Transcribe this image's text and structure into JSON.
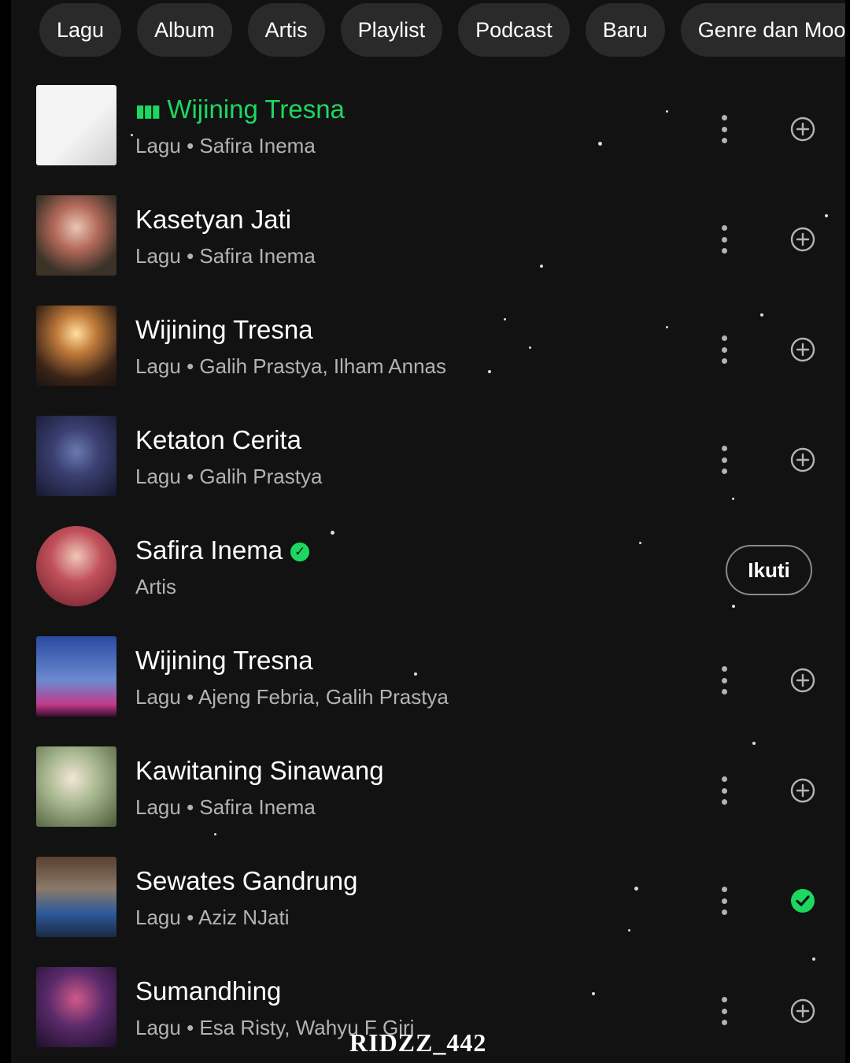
{
  "filters": [
    "Lagu",
    "Album",
    "Artis",
    "Playlist",
    "Podcast",
    "Baru",
    "Genre dan Mood"
  ],
  "results": [
    {
      "title": "Wijining Tresna",
      "type": "Lagu",
      "artists": "Safira Inema",
      "playing": true,
      "saved": false
    },
    {
      "title": "Kasetyan Jati",
      "type": "Lagu",
      "artists": "Safira Inema",
      "playing": false,
      "saved": false
    },
    {
      "title": "Wijining Tresna",
      "type": "Lagu",
      "artists": "Galih Prastya, Ilham Annas",
      "playing": false,
      "saved": false
    },
    {
      "title": "Ketaton Cerita",
      "type": "Lagu",
      "artists": "Galih Prastya",
      "playing": false,
      "saved": false
    },
    {
      "title": "Safira Inema",
      "type": "Artis",
      "verified": true,
      "follow_label": "Ikuti"
    },
    {
      "title": "Wijining Tresna",
      "type": "Lagu",
      "artists": "Ajeng Febria, Galih Prastya",
      "playing": false,
      "saved": false
    },
    {
      "title": "Kawitaning Sinawang",
      "type": "Lagu",
      "artists": "Safira Inema",
      "playing": false,
      "saved": false
    },
    {
      "title": "Sewates Gandrung",
      "type": "Lagu",
      "artists": "Aziz NJati",
      "playing": false,
      "saved": true
    },
    {
      "title": "Sumandhing",
      "type": "Lagu",
      "artists": "Esa Risty, Wahyu F Giri",
      "playing": false,
      "saved": false
    }
  ],
  "separator": "•",
  "watermark": "RIDZZ_442",
  "colors": {
    "accent": "#1ed760",
    "background": "#121212",
    "chip": "#2a2a2a",
    "secondary_text": "#b3b3b3"
  },
  "icons": {
    "more": "more-vertical-icon",
    "add": "add-circle-icon",
    "saved": "check-circle-icon",
    "playing": "equalizer-icon",
    "verified": "verified-badge-icon"
  }
}
